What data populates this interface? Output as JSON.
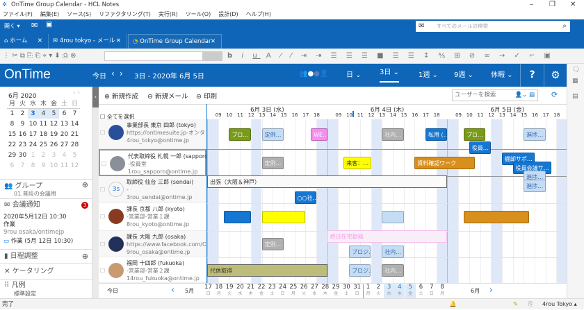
{
  "window": {
    "title": "OnTime Group Calendar - HCL Notes"
  },
  "menu": [
    "ファイル(F)",
    "編集(E)",
    "ソース(S)",
    "リファクタリング(T)",
    "実行(R)",
    "ツール(O)",
    "設計(D)",
    "ヘルプ(H)"
  ],
  "bluebar": {
    "open_label": "開く",
    "search_placeholder": "すべてのメールの検索"
  },
  "tabs": [
    {
      "label": "ホーム",
      "icon": "home-icon"
    },
    {
      "label": "4rou tokyo - メール",
      "icon": "mail-icon"
    },
    {
      "label": "OnTime Group Calendar",
      "icon": "ontime-icon",
      "active": true
    }
  ],
  "ontime": {
    "logo": "OnTime",
    "today": "今日",
    "range": "3日 - 2020年 6月 5日",
    "views": [
      "日",
      "3日",
      "1週",
      "9週",
      "休暇"
    ],
    "active_view": "3日",
    "help": "?"
  },
  "minical": {
    "title": "6月 2020",
    "weekdays": [
      "月",
      "火",
      "水",
      "木",
      "金",
      "土",
      "日"
    ],
    "weeks": [
      [
        "1",
        "2",
        "3",
        "4",
        "5",
        "6",
        "7"
      ],
      [
        "8",
        "9",
        "10",
        "11",
        "12",
        "13",
        "14"
      ],
      [
        "15",
        "16",
        "17",
        "18",
        "19",
        "20",
        "21"
      ],
      [
        "22",
        "23",
        "24",
        "25",
        "26",
        "27",
        "28"
      ],
      [
        "29",
        "30",
        "1",
        "2",
        "3",
        "4",
        "5"
      ],
      [
        "6",
        "7",
        "8",
        "9",
        "10",
        "11",
        "12"
      ]
    ]
  },
  "left": {
    "group_label": "グループ",
    "group_sub": "01.普段の会議用",
    "invite_label": "会議通知",
    "invite_count": "3",
    "invite_date": "2020年5月12日  10:30",
    "invite_title": "作業",
    "invite_from": "9rou osaka/ontimejp",
    "invite_item": "作業 (5月 12日 10:30)",
    "schedule_label": "日程調整",
    "catering_label": "ケータリング",
    "legend_label": "凡例",
    "legend_sub": "標準設定"
  },
  "actions": {
    "new": "新規作成",
    "new_mail": "新規メール",
    "print": "印刷",
    "user_search": "ユーザーを検索",
    "select_all": "全てを選択"
  },
  "days": [
    {
      "label": "6月 3日 (水)"
    },
    {
      "label": "6月 4日 (木)"
    },
    {
      "label": "6月 5日 (金)"
    }
  ],
  "hours": [
    "09",
    "10",
    "11",
    "12",
    "13",
    "14",
    "15",
    "16",
    "17",
    "18"
  ],
  "people": [
    {
      "name": "事業部長 東京 四郎 (tokyo)",
      "sub": "https://ontimesuite.jp-オンタイム",
      "mail": "4rou_tokyo@ontime.jp",
      "avatar": "#2a4f9a"
    },
    {
      "name": "代表取締役 札幌 一郎 (sapporo)",
      "sub": "-役員室",
      "mail": "1rou_sapporo@ontime.jp",
      "avatar": "#8a8f99"
    },
    {
      "name": "取締役 仙台 三郎 (sendai)",
      "sub": "-",
      "mail": "3rou_sendai@ontime.jp",
      "initials": "3s"
    },
    {
      "name": "課長 京都 八郎 (kyoto)",
      "sub": "-営業部-営業１課",
      "mail": "8rou_kyoto@ontime.jp",
      "avatar": "#8a3a20"
    },
    {
      "name": "課長 大阪 九郎 (osaka)",
      "sub": "https://www.facebook.com/O...",
      "mail": "9rou_osaka@ontime.jp",
      "avatar": "#23315a"
    },
    {
      "name": "福岡 十四郎 (fukuoka)",
      "sub": "-営業部-営業２課",
      "mail": "14rou_fukuoka@ontime.jp",
      "avatar": "#c89a70"
    }
  ],
  "events": [
    {
      "row": 0,
      "lane": 0,
      "sd": 0,
      "sh": 10,
      "ed": 0,
      "eh": 12,
      "label": "プロ…",
      "bg": "#7a9a1a",
      "fg": "#fff"
    },
    {
      "row": 0,
      "lane": 0,
      "sd": 0,
      "sh": 13,
      "ed": 0,
      "eh": 15,
      "label": "定例…",
      "bg": "#c5dcf5",
      "fg": "#3a6aa8"
    },
    {
      "row": 0,
      "lane": 0,
      "sd": 0,
      "sh": 17.5,
      "ed": 0,
      "eh": 19,
      "label": "WE…",
      "bg": "#f58ef0",
      "fg": "#fff"
    },
    {
      "row": 0,
      "lane": 0,
      "sd": 1,
      "sh": 13,
      "ed": 1,
      "eh": 15,
      "label": "社内…",
      "bg": "#b0b0b0",
      "fg": "#eee"
    },
    {
      "row": 0,
      "lane": 0,
      "sd": 1,
      "sh": 17,
      "ed": 1,
      "eh": 19,
      "label": "私用 (…",
      "bg": "#1677d2",
      "fg": "#fff"
    },
    {
      "row": 0,
      "lane": 0,
      "sd": 2,
      "sh": 9.5,
      "ed": 2,
      "eh": 11.5,
      "label": "プロ…",
      "bg": "#7a9a1a",
      "fg": "#fff"
    },
    {
      "row": 0,
      "lane": 1,
      "sd": 2,
      "sh": 10,
      "ed": 2,
      "eh": 12,
      "label": "役員…",
      "bg": "#1677d2",
      "fg": "#fff"
    },
    {
      "row": 0,
      "lane": 0,
      "sd": 2,
      "sh": 15,
      "ed": 2,
      "eh": 17,
      "label": "進捗…",
      "bg": "#c5dcf5",
      "fg": "#3a6aa8"
    },
    {
      "row": 1,
      "lane": 0,
      "sd": 0,
      "sh": 13,
      "ed": 0,
      "eh": 15,
      "label": "定例…",
      "bg": "#b0b0b0",
      "fg": "#eee"
    },
    {
      "row": 1,
      "lane": 0,
      "sd": 1,
      "sh": 9.5,
      "ed": 1,
      "eh": 12,
      "label": "来客：…",
      "bg": "#ffff00",
      "fg": "#333"
    },
    {
      "row": 1,
      "lane": 0,
      "sd": 1,
      "sh": 16,
      "ed": 2,
      "eh": 10.5,
      "label": "資料確認ワーク",
      "bg": "#d98f1c",
      "fg": "#fff"
    },
    {
      "row": 1,
      "lane": -0.3,
      "sd": 2,
      "sh": 13,
      "ed": 2,
      "eh": 16,
      "label": "棚卸サポ…",
      "bg": "#1677d2",
      "fg": "#fff"
    },
    {
      "row": 1,
      "lane": 0.4,
      "sd": 2,
      "sh": 14,
      "ed": 2,
      "eh": 17.5,
      "label": "役員会議サ…",
      "bg": "#1677d2",
      "fg": "#fff"
    },
    {
      "row": 1,
      "lane": 1.1,
      "sd": 2,
      "sh": 15,
      "ed": 2,
      "eh": 17,
      "label": "進捗…",
      "bg": "#c5dcf5",
      "fg": "#3a6aa8"
    },
    {
      "row": 2,
      "lane": -0.6,
      "sd": 0,
      "sh": 8,
      "ed": 1,
      "eh": 19,
      "label": "出張（大阪＆神戸）",
      "bg": "#fafafa",
      "fg": "#333",
      "full": true
    },
    {
      "row": 2,
      "lane": 0.6,
      "sd": 0,
      "sh": 16,
      "ed": 0,
      "eh": 18,
      "label": "○○社…",
      "bg": "#1677d2",
      "fg": "#fff"
    },
    {
      "row": 2,
      "lane": -0.3,
      "sd": 2,
      "sh": 15,
      "ed": 2,
      "eh": 17,
      "label": "進捗…",
      "bg": "#c5dcf5",
      "fg": "#3a6aa8"
    },
    {
      "row": 3,
      "lane": 0,
      "sd": 0,
      "sh": 9.5,
      "ed": 0,
      "eh": 12,
      "label": "",
      "bg": "#1677d2",
      "fg": "#fff"
    },
    {
      "row": 3,
      "lane": 0,
      "sd": 0,
      "sh": 13,
      "ed": 0,
      "eh": 17,
      "label": "",
      "bg": "#ffff00",
      "fg": "#333"
    },
    {
      "row": 3,
      "lane": 0,
      "sd": 1,
      "sh": 13,
      "ed": 1,
      "eh": 15,
      "label": "",
      "bg": "#c5dcf5",
      "fg": "#3a6aa8"
    },
    {
      "row": 3,
      "lane": 0,
      "sd": 2,
      "sh": 9.5,
      "ed": 2,
      "eh": 15.5,
      "label": "",
      "bg": "#d98f1c",
      "fg": "#fff"
    },
    {
      "row": 4,
      "lane": 0,
      "sd": 0,
      "sh": 13,
      "ed": 0,
      "eh": 15,
      "label": "定例…",
      "bg": "#b0b0b0",
      "fg": "#eee"
    },
    {
      "row": 4,
      "lane": -0.6,
      "sd": 1,
      "sh": 8,
      "ed": 1,
      "eh": 19,
      "label": "終日在宅勤務",
      "bg": "#f7eef7",
      "fg": "#f59de8",
      "full": true
    },
    {
      "row": 4,
      "lane": 0.6,
      "sd": 1,
      "sh": 10,
      "ed": 1,
      "eh": 12,
      "label": "プロジ…",
      "bg": "#c5dcf5",
      "fg": "#3a6aa8"
    },
    {
      "row": 4,
      "lane": 0.6,
      "sd": 1,
      "sh": 13,
      "ed": 1,
      "eh": 15,
      "label": "社内…",
      "bg": "#c5dcf5",
      "fg": "#3a6aa8"
    },
    {
      "row": 5,
      "lane": 0,
      "sd": 0,
      "sh": 8,
      "ed": 0,
      "eh": 19,
      "label": "代休取得",
      "bg": "#bcbd78",
      "fg": "#333",
      "full": true
    },
    {
      "row": 5,
      "lane": 0,
      "sd": 1,
      "sh": 10,
      "ed": 1,
      "eh": 12,
      "label": "プロジ…",
      "bg": "#c5dcf5",
      "fg": "#3a6aa8"
    },
    {
      "row": 5,
      "lane": 0,
      "sd": 1,
      "sh": 13,
      "ed": 1,
      "eh": 15,
      "label": "社内…",
      "bg": "#b0b0b0",
      "fg": "#eee"
    }
  ],
  "footer": {
    "today": "今日",
    "prev_month": "5月",
    "next_month": "6月",
    "dates": [
      [
        "17",
        "日"
      ],
      [
        "18",
        "月"
      ],
      [
        "19",
        "火"
      ],
      [
        "20",
        "水"
      ],
      [
        "21",
        "木"
      ],
      [
        "22",
        "金"
      ],
      [
        "23",
        "土"
      ],
      [
        "24",
        "日"
      ],
      [
        "25",
        "月"
      ],
      [
        "26",
        "火"
      ],
      [
        "27",
        "水"
      ],
      [
        "28",
        "木"
      ],
      [
        "29",
        "金"
      ],
      [
        "30",
        "土"
      ],
      [
        "31",
        "日"
      ],
      [
        "1",
        "月"
      ],
      [
        "2",
        "火"
      ],
      [
        "3",
        "水"
      ],
      [
        "4",
        "木"
      ],
      [
        "5",
        "金"
      ],
      [
        "6",
        "土"
      ],
      [
        "7",
        "日"
      ],
      [
        "8",
        "月"
      ]
    ]
  },
  "status": {
    "text": "完了",
    "user": "4rou Tokyo"
  },
  "colors": {
    "brand": "#0f66b8",
    "accent": "#1677d2"
  }
}
